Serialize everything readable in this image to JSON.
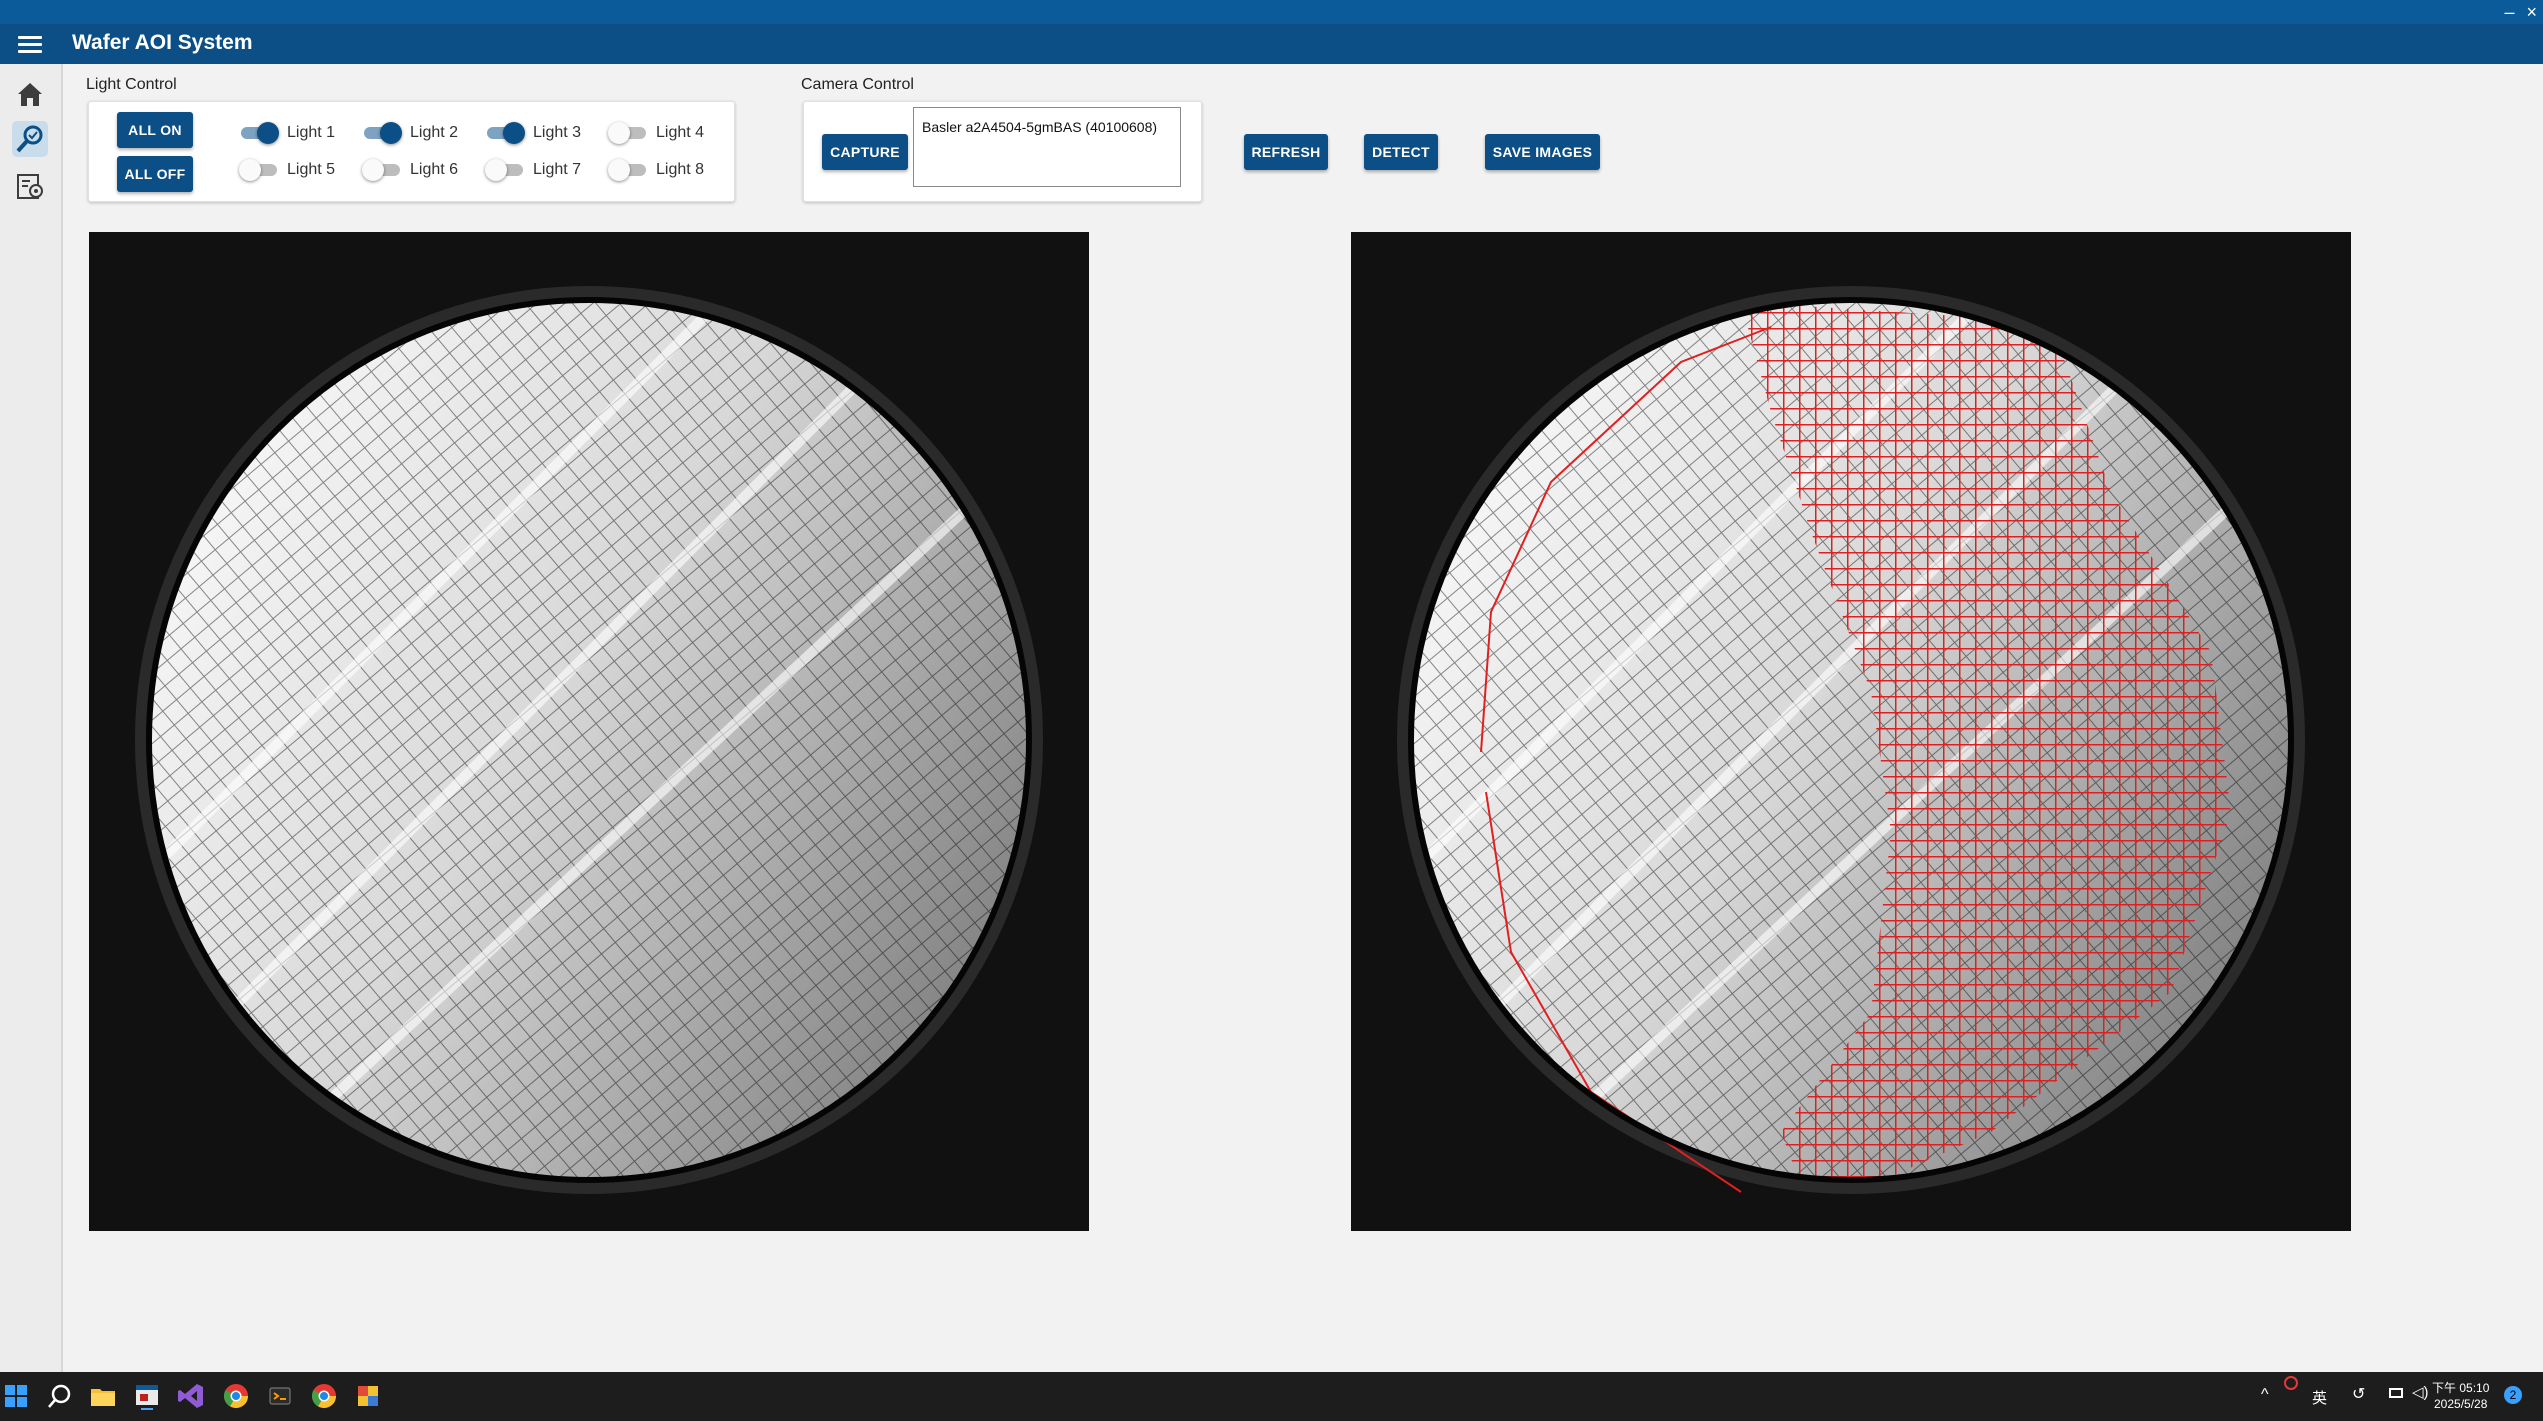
{
  "app": {
    "title": "Wafer AOI System"
  },
  "window_controls": {
    "minimize": "–",
    "close": "×"
  },
  "rail": {
    "items": [
      "home-icon",
      "inspection-icon",
      "settings-report-icon"
    ],
    "active": 1
  },
  "light_control": {
    "label": "Light Control",
    "all_on_label": "ALL ON",
    "all_off_label": "ALL OFF",
    "lights": [
      {
        "label": "Light 1",
        "on": true
      },
      {
        "label": "Light 2",
        "on": true
      },
      {
        "label": "Light 3",
        "on": true
      },
      {
        "label": "Light 4",
        "on": false
      },
      {
        "label": "Light 5",
        "on": false
      },
      {
        "label": "Light 6",
        "on": false
      },
      {
        "label": "Light 7",
        "on": false
      },
      {
        "label": "Light 8",
        "on": false
      }
    ]
  },
  "camera_control": {
    "label": "Camera Control",
    "capture_label": "CAPTURE",
    "selected_camera": "Basler a2A4504-5gmBAS (40100608)"
  },
  "actions": {
    "refresh_label": "REFRESH",
    "detect_label": "DETECT",
    "save_images_label": "SAVE IMAGES"
  },
  "colors": {
    "accent": "#0b4f86",
    "titlebar": "#0b5a9a",
    "defect": "#e02020",
    "taskbar": "#1d1d1d"
  },
  "taskbar": {
    "icons": [
      "windows-start-icon",
      "search-icon",
      "file-explorer-icon",
      "app-window-icon",
      "visual-studio-icon",
      "chrome-icon",
      "terminal-icon",
      "chrome-icon",
      "paint-icon"
    ],
    "tray": {
      "ime": "英",
      "time_period": "下午",
      "time": "05:10",
      "date": "2025/5/28",
      "notification_count": "2"
    }
  }
}
